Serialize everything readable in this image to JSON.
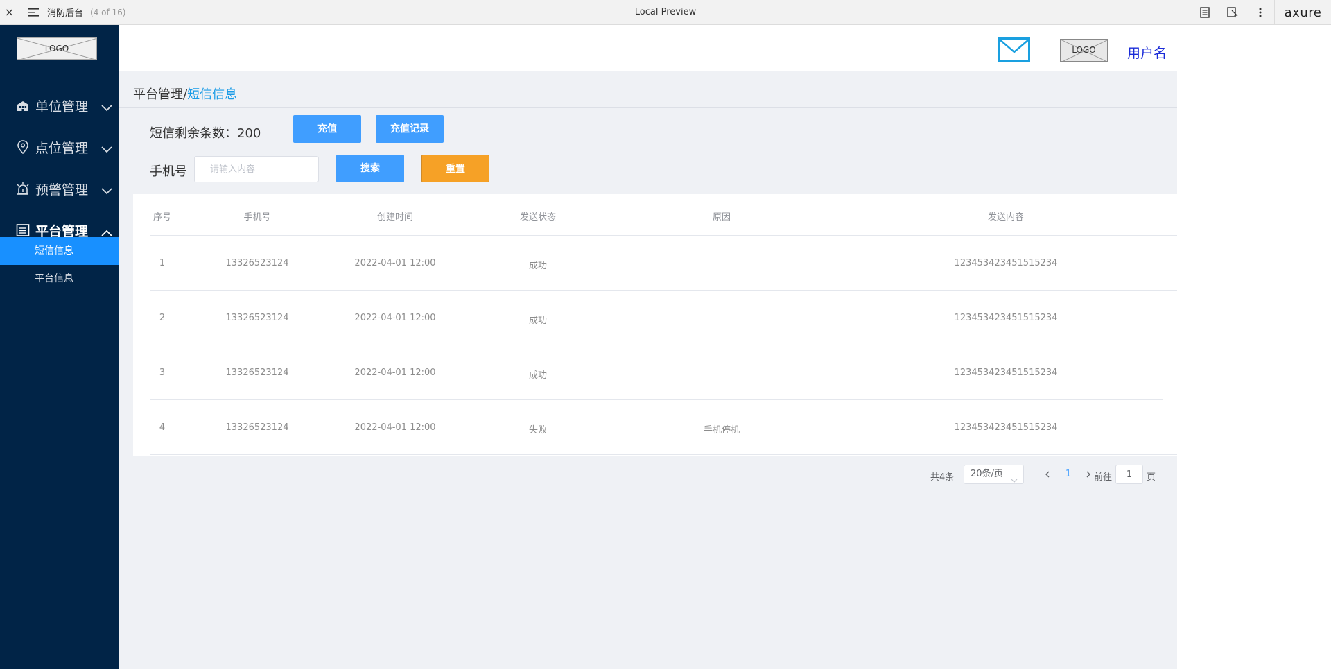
{
  "topbar": {
    "close": "×",
    "title": "消防后台",
    "page_count": "(4 of 16)",
    "center_title": "Local Preview",
    "brand": "axure"
  },
  "sidebar": {
    "logo": "LOGO",
    "groups": [
      {
        "label": "单位管理",
        "icon": "building-icon",
        "expanded": false
      },
      {
        "label": "点位管理",
        "icon": "location-pin-icon",
        "expanded": false
      },
      {
        "label": "预警管理",
        "icon": "alarm-light-icon",
        "expanded": false
      },
      {
        "label": "平台管理",
        "icon": "platform-list-icon",
        "expanded": true
      }
    ],
    "sub_items": [
      {
        "label": "短信信息",
        "active": true
      },
      {
        "label": "平台信息",
        "active": false
      }
    ]
  },
  "header": {
    "logo": "LOGO",
    "username": "用户名"
  },
  "breadcrumb": {
    "parent": "平台管理",
    "separator": "/",
    "current": "短信信息"
  },
  "sms": {
    "remaining_label": "短信剩余条数：200",
    "recharge_button": "充值",
    "records_button": "充值记录"
  },
  "search": {
    "phone_label": "手机号",
    "phone_placeholder": "请输入内容",
    "search_button": "搜索",
    "reset_button": "重置"
  },
  "table": {
    "headers": [
      "序号",
      "手机号",
      "创建时间",
      "发送状态",
      "原因",
      "发送内容"
    ],
    "rows": [
      [
        "1",
        "13326523124",
        "2022-04-01 12:00",
        "成功",
        "",
        "123453423451515234"
      ],
      [
        "2",
        "13326523124",
        "2022-04-01 12:00",
        "成功",
        "",
        "123453423451515234"
      ],
      [
        "3",
        "13326523124",
        "2022-04-01 12:00",
        "成功",
        "",
        "123453423451515234"
      ],
      [
        "4",
        "13326523124",
        "2022-04-01 12:00",
        "失败",
        "手机停机",
        "123453423451515234"
      ]
    ]
  },
  "pagination": {
    "total": "共4条",
    "page_size": "20条/页",
    "current_page": "1",
    "goto_label": "前往",
    "goto_value": "1",
    "unit": "页"
  },
  "colors": {
    "sidebar_bg": "#012447",
    "primary": "#409eff",
    "active_nav": "#1890ff",
    "reset": "#f6a126",
    "breadcrumb_current": "#1a9be6",
    "username": "#1a2bd8",
    "mail_icon": "#1aa0e0"
  }
}
